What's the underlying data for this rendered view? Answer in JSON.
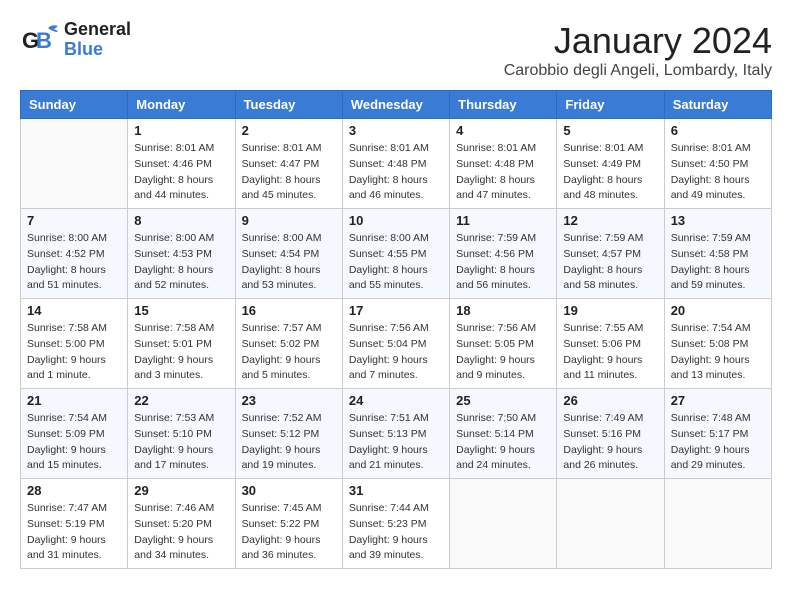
{
  "header": {
    "logo_general": "General",
    "logo_blue": "Blue",
    "month_title": "January 2024",
    "location": "Carobbio degli Angeli, Lombardy, Italy"
  },
  "days_of_week": [
    "Sunday",
    "Monday",
    "Tuesday",
    "Wednesday",
    "Thursday",
    "Friday",
    "Saturday"
  ],
  "weeks": [
    [
      {
        "day": "",
        "info": ""
      },
      {
        "day": "1",
        "info": "Sunrise: 8:01 AM\nSunset: 4:46 PM\nDaylight: 8 hours\nand 44 minutes."
      },
      {
        "day": "2",
        "info": "Sunrise: 8:01 AM\nSunset: 4:47 PM\nDaylight: 8 hours\nand 45 minutes."
      },
      {
        "day": "3",
        "info": "Sunrise: 8:01 AM\nSunset: 4:48 PM\nDaylight: 8 hours\nand 46 minutes."
      },
      {
        "day": "4",
        "info": "Sunrise: 8:01 AM\nSunset: 4:48 PM\nDaylight: 8 hours\nand 47 minutes."
      },
      {
        "day": "5",
        "info": "Sunrise: 8:01 AM\nSunset: 4:49 PM\nDaylight: 8 hours\nand 48 minutes."
      },
      {
        "day": "6",
        "info": "Sunrise: 8:01 AM\nSunset: 4:50 PM\nDaylight: 8 hours\nand 49 minutes."
      }
    ],
    [
      {
        "day": "7",
        "info": "Sunrise: 8:00 AM\nSunset: 4:52 PM\nDaylight: 8 hours\nand 51 minutes."
      },
      {
        "day": "8",
        "info": "Sunrise: 8:00 AM\nSunset: 4:53 PM\nDaylight: 8 hours\nand 52 minutes."
      },
      {
        "day": "9",
        "info": "Sunrise: 8:00 AM\nSunset: 4:54 PM\nDaylight: 8 hours\nand 53 minutes."
      },
      {
        "day": "10",
        "info": "Sunrise: 8:00 AM\nSunset: 4:55 PM\nDaylight: 8 hours\nand 55 minutes."
      },
      {
        "day": "11",
        "info": "Sunrise: 7:59 AM\nSunset: 4:56 PM\nDaylight: 8 hours\nand 56 minutes."
      },
      {
        "day": "12",
        "info": "Sunrise: 7:59 AM\nSunset: 4:57 PM\nDaylight: 8 hours\nand 58 minutes."
      },
      {
        "day": "13",
        "info": "Sunrise: 7:59 AM\nSunset: 4:58 PM\nDaylight: 8 hours\nand 59 minutes."
      }
    ],
    [
      {
        "day": "14",
        "info": "Sunrise: 7:58 AM\nSunset: 5:00 PM\nDaylight: 9 hours\nand 1 minute."
      },
      {
        "day": "15",
        "info": "Sunrise: 7:58 AM\nSunset: 5:01 PM\nDaylight: 9 hours\nand 3 minutes."
      },
      {
        "day": "16",
        "info": "Sunrise: 7:57 AM\nSunset: 5:02 PM\nDaylight: 9 hours\nand 5 minutes."
      },
      {
        "day": "17",
        "info": "Sunrise: 7:56 AM\nSunset: 5:04 PM\nDaylight: 9 hours\nand 7 minutes."
      },
      {
        "day": "18",
        "info": "Sunrise: 7:56 AM\nSunset: 5:05 PM\nDaylight: 9 hours\nand 9 minutes."
      },
      {
        "day": "19",
        "info": "Sunrise: 7:55 AM\nSunset: 5:06 PM\nDaylight: 9 hours\nand 11 minutes."
      },
      {
        "day": "20",
        "info": "Sunrise: 7:54 AM\nSunset: 5:08 PM\nDaylight: 9 hours\nand 13 minutes."
      }
    ],
    [
      {
        "day": "21",
        "info": "Sunrise: 7:54 AM\nSunset: 5:09 PM\nDaylight: 9 hours\nand 15 minutes."
      },
      {
        "day": "22",
        "info": "Sunrise: 7:53 AM\nSunset: 5:10 PM\nDaylight: 9 hours\nand 17 minutes."
      },
      {
        "day": "23",
        "info": "Sunrise: 7:52 AM\nSunset: 5:12 PM\nDaylight: 9 hours\nand 19 minutes."
      },
      {
        "day": "24",
        "info": "Sunrise: 7:51 AM\nSunset: 5:13 PM\nDaylight: 9 hours\nand 21 minutes."
      },
      {
        "day": "25",
        "info": "Sunrise: 7:50 AM\nSunset: 5:14 PM\nDaylight: 9 hours\nand 24 minutes."
      },
      {
        "day": "26",
        "info": "Sunrise: 7:49 AM\nSunset: 5:16 PM\nDaylight: 9 hours\nand 26 minutes."
      },
      {
        "day": "27",
        "info": "Sunrise: 7:48 AM\nSunset: 5:17 PM\nDaylight: 9 hours\nand 29 minutes."
      }
    ],
    [
      {
        "day": "28",
        "info": "Sunrise: 7:47 AM\nSunset: 5:19 PM\nDaylight: 9 hours\nand 31 minutes."
      },
      {
        "day": "29",
        "info": "Sunrise: 7:46 AM\nSunset: 5:20 PM\nDaylight: 9 hours\nand 34 minutes."
      },
      {
        "day": "30",
        "info": "Sunrise: 7:45 AM\nSunset: 5:22 PM\nDaylight: 9 hours\nand 36 minutes."
      },
      {
        "day": "31",
        "info": "Sunrise: 7:44 AM\nSunset: 5:23 PM\nDaylight: 9 hours\nand 39 minutes."
      },
      {
        "day": "",
        "info": ""
      },
      {
        "day": "",
        "info": ""
      },
      {
        "day": "",
        "info": ""
      }
    ]
  ]
}
